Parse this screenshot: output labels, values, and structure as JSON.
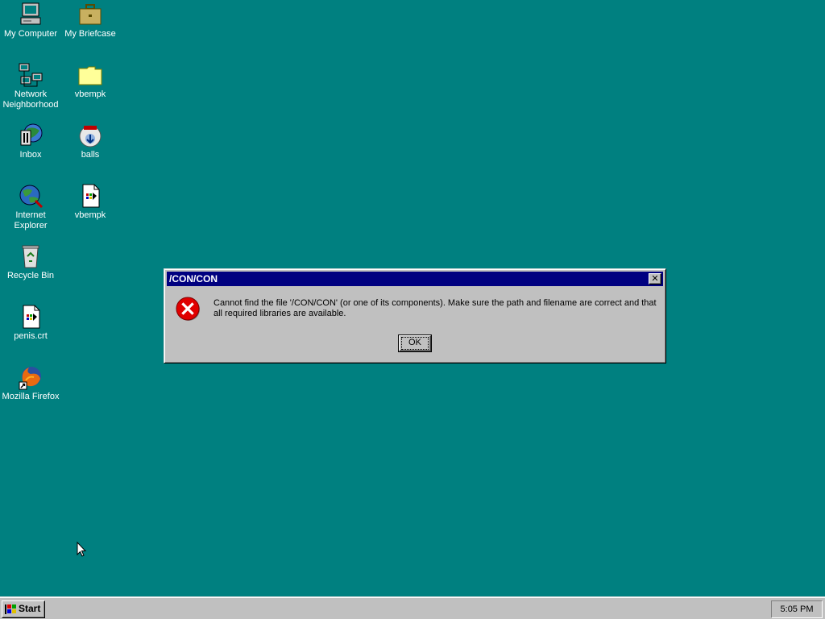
{
  "desktop": {
    "background": "#008080",
    "icons": [
      {
        "label": "My Computer",
        "icon": "my-computer-icon"
      },
      {
        "label": "My Briefcase",
        "icon": "briefcase-icon"
      },
      {
        "label": "Network Neighborhood",
        "icon": "network-icon"
      },
      {
        "label": "vbempk",
        "icon": "folder-icon"
      },
      {
        "label": "Inbox",
        "icon": "inbox-icon"
      },
      {
        "label": "balls",
        "icon": "installer-icon"
      },
      {
        "label": "Internet Explorer",
        "icon": "internet-explorer-icon"
      },
      {
        "label": "vbempk",
        "icon": "file-icon"
      },
      {
        "label": "Recycle Bin",
        "icon": "recycle-bin-icon"
      },
      {
        "label": "penis.crt",
        "icon": "file-icon"
      },
      {
        "label": "Mozilla Firefox",
        "icon": "firefox-shortcut-icon"
      }
    ]
  },
  "dialog": {
    "title": "/CON/CON",
    "close_glyph": "✕",
    "icon": "error-icon",
    "message": "Cannot find the file '/CON/CON' (or one of its components). Make sure the path and filename are correct and that all required libraries are available.",
    "ok_label": "OK"
  },
  "taskbar": {
    "start_label": "Start",
    "clock": "5:05 PM"
  }
}
